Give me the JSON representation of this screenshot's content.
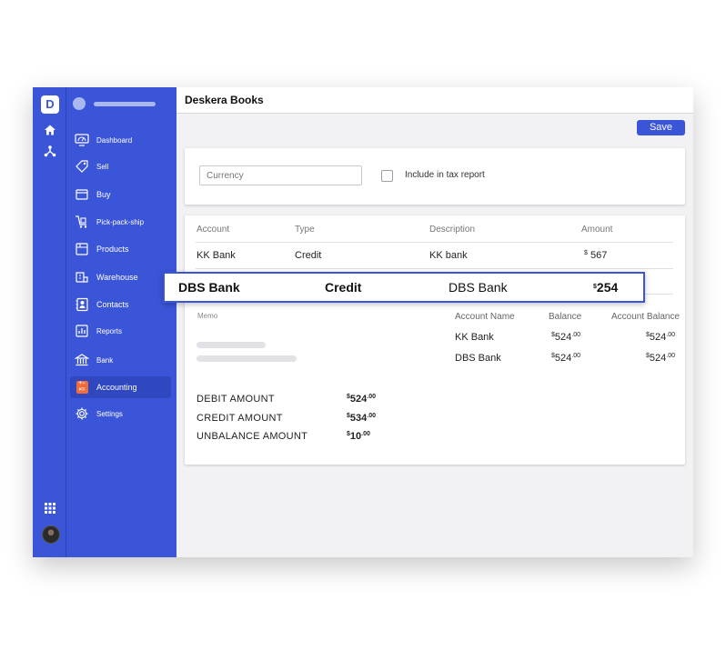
{
  "app": {
    "title": "Deskera Books",
    "logo_letter": "D"
  },
  "rail": {
    "icons": [
      "home-icon",
      "network-icon",
      "apps-grid-icon"
    ]
  },
  "sidebar": {
    "items": [
      {
        "label": "Dashboard",
        "icon": "dashboard-icon"
      },
      {
        "label": "Sell",
        "icon": "sell-icon"
      },
      {
        "label": "Buy",
        "icon": "buy-icon"
      },
      {
        "label": "Pick-pack-ship",
        "icon": "cart-icon"
      },
      {
        "label": "Products",
        "icon": "products-icon"
      },
      {
        "label": "Warehouse",
        "icon": "warehouse-icon"
      },
      {
        "label": "Contacts",
        "icon": "contacts-icon"
      },
      {
        "label": "Reports",
        "icon": "reports-icon"
      },
      {
        "label": "Bank",
        "icon": "bank-icon"
      },
      {
        "label": "Accounting",
        "icon": "calculator-icon",
        "active": true
      },
      {
        "label": "Settings",
        "icon": "gear-icon"
      }
    ]
  },
  "toolbar": {
    "save_label": "Save"
  },
  "filters": {
    "currency_placeholder": "Currency",
    "tax_label": "Include in tax report"
  },
  "table": {
    "headers": [
      "Account",
      "Type",
      "Description",
      "Amount"
    ],
    "rows": [
      {
        "account": "KK Bank",
        "type": "Credit",
        "description": "KK bank",
        "currency": "$",
        "amount": "567"
      }
    ]
  },
  "highlight": {
    "account": "DBS Bank",
    "type": "Credit",
    "description": "DBS Bank",
    "currency": "$",
    "amount": "254"
  },
  "memo": {
    "label": "Memo"
  },
  "balances": {
    "headers": [
      "Account Name",
      "Balance",
      "Account Balance"
    ],
    "rows": [
      {
        "name": "KK Bank",
        "cur": "$",
        "balance": "524",
        "balance_dec": ".00",
        "acc_cur": "$",
        "account_balance": "524",
        "account_balance_dec": ".00"
      },
      {
        "name": "DBS  Bank",
        "cur": "$",
        "balance": "524",
        "balance_dec": ".00",
        "acc_cur": "$",
        "account_balance": "524",
        "account_balance_dec": ".00"
      }
    ]
  },
  "summary": [
    {
      "label": "DEBIT AMOUNT",
      "cur": "$",
      "value": "524",
      "dec": ".00"
    },
    {
      "label": "CREDIT AMOUNT",
      "cur": "$",
      "value": "534",
      "dec": ".00"
    },
    {
      "label": "UNBALANCE AMOUNT",
      "cur": "$",
      "value": "10",
      "dec": ".00"
    }
  ],
  "colors": {
    "brand": "#3b55d8",
    "accent_orange": "#f26b3a"
  }
}
